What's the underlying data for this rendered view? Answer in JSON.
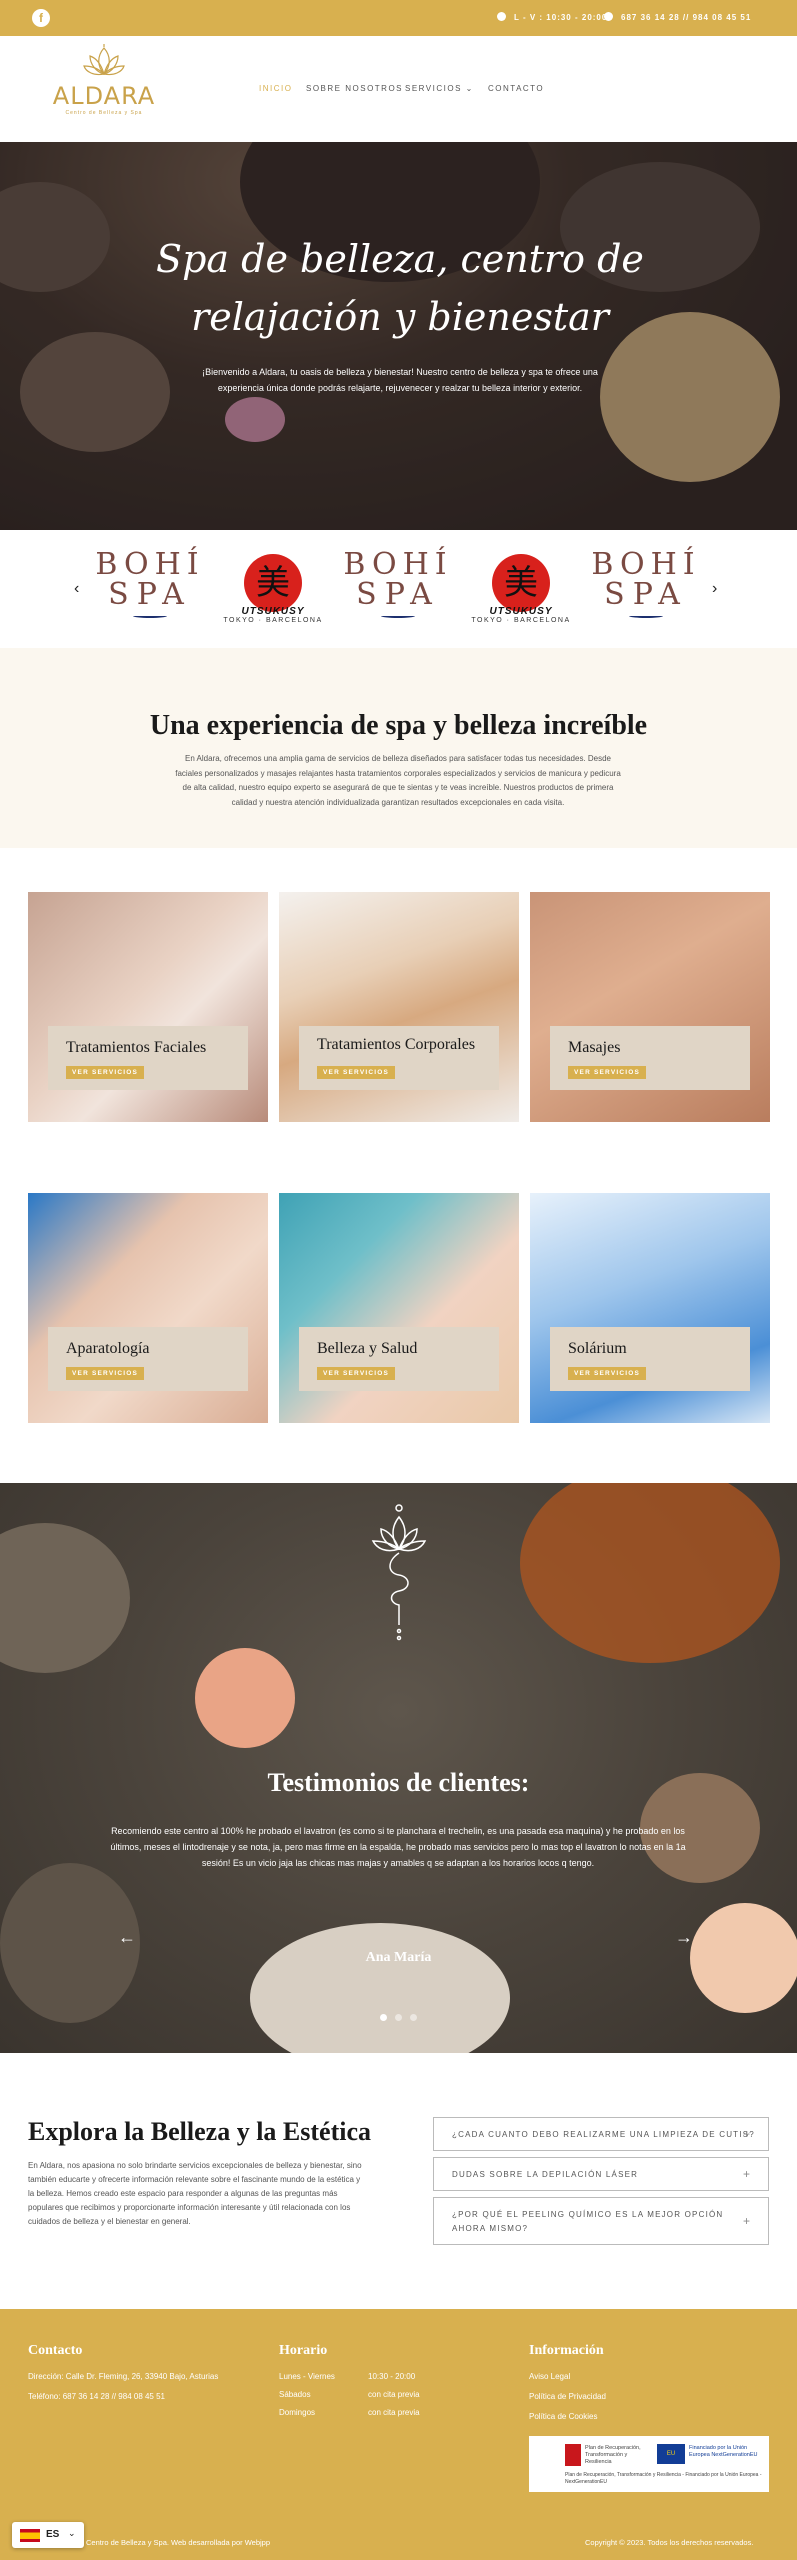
{
  "topbar": {
    "facebook_icon": "facebook-icon",
    "hours": "L - V : 10:30 - 20:00",
    "phone": "687 36 14 28 // 984 08 45 51"
  },
  "header": {
    "logo_word": "ALDARA",
    "logo_sub": "Centro de Belleza y Spa",
    "nav": [
      "INICIO",
      "SOBRE NOSOTROS",
      "SERVICIOS",
      "CONTACTO"
    ]
  },
  "hero": {
    "title": "Spa de belleza, centro de relajación y bienestar",
    "text": "¡Bienvenido a Aldara, tu oasis de belleza y bienestar! Nuestro centro de belleza y spa te ofrece una experiencia única donde podrás relajarte, rejuvenecer y realzar tu belleza interior y exterior."
  },
  "brands": {
    "bohi_line1": "BOHÍ",
    "bohi_line2": "SPA",
    "uts_glyph": "美",
    "uts_name": "UTSUKUSY",
    "uts_city": "TOKYO · BARCELONA"
  },
  "experience": {
    "title": "Una experiencia de spa y belleza increíble",
    "text": "En Aldara, ofrecemos una amplia gama de servicios de belleza diseñados para satisfacer todas tus necesidades. Desde faciales personalizados y masajes relajantes hasta tratamientos corporales especializados y servicios de manicura y pedicura de alta calidad, nuestro equipo experto se asegurará de que te sientas y te veas increíble. Nuestros productos de primera calidad y nuestra atención individualizada garantizan resultados excepcionales en cada visita."
  },
  "services": {
    "button_label": "VER SERVICIOS",
    "items": [
      {
        "title": "Tratamientos Faciales"
      },
      {
        "title": "Tratamientos Corporales"
      },
      {
        "title": "Masajes"
      },
      {
        "title": "Aparatología"
      },
      {
        "title": "Belleza y Salud"
      },
      {
        "title": "Solárium"
      }
    ]
  },
  "testimonials": {
    "title": "Testimonios de clientes:",
    "text": "Recomiendo este centro al 100% he probado el lavatron (es como si te planchara el trechelin, es una pasada esa maquina) y he probado en los últimos, meses el lintodrenaje y se nota, ja, pero mas firme en la espalda, he probado mas servicios pero lo mas top el lavatron lo notas en la 1a sesión! Es un vicio jaja las chicas mas majas y amables q se adaptan a los horarios locos q tengo.",
    "author": "Ana María"
  },
  "explore": {
    "title": "Explora la Belleza y la Estética",
    "text": "En Aldara, nos apasiona no solo brindarte servicios excepcionales de belleza y bienestar, sino también educarte y ofrecerte información relevante sobre el fascinante mundo de la estética y la belleza. Hemos creado este espacio para responder a algunas de las preguntas más populares que recibimos y proporcionarte información interesante y útil relacionada con los cuidados de belleza y el bienestar en general.",
    "faqs": [
      "¿CADA CUANTO DEBO REALIZARME UNA LIMPIEZA DE CUTIS?",
      "DUDAS SOBRE LA DEPILACIÓN LÁSER",
      "¿POR QUÉ EL PEELING QUÍMICO ES LA MEJOR OPCIÓN AHORA MISMO?"
    ]
  },
  "footer": {
    "contact_title": "Contacto",
    "address": "Dirección: Calle Dr. Fleming, 26, 33940 Bajo, Asturias",
    "phones": "Teléfono: 687 36 14 28 // 984 08 45 51",
    "hours_title": "Horario",
    "hours": [
      {
        "day": "Lunes - Viernes",
        "time": "10:30 - 20:00"
      },
      {
        "day": "Sábados",
        "time": "con cita previa"
      },
      {
        "day": "Domingos",
        "time": "con cita previa"
      }
    ],
    "info_title": "Información",
    "links": [
      "Aviso Legal",
      "Política de Privacidad",
      "Política de Cookies"
    ],
    "eu_t1": "Plan de Recuperación, Transformación y Resiliencia",
    "eu_flag": "EU",
    "eu_t2": "Financiado por la Unión Europea NextGenerationEU",
    "eu_t3": "Plan de Recuperación, Transformación y Resiliencia - Financiado por la Unión Europea -NextGenerationEU",
    "credit": "Centro de Belleza y Spa. Web desarrollada por Webjpp",
    "copyright": "Copyright © 2023. Todos los derechos reservados.",
    "lang_code": "ES"
  }
}
